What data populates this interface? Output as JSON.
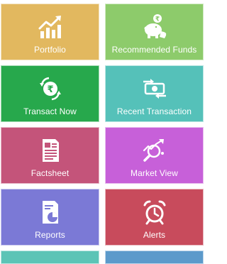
{
  "tiles": [
    {
      "label": "Portfolio",
      "icon": "growth-chart-icon",
      "color": "#e2b85f"
    },
    {
      "label": "Recommended Funds",
      "icon": "piggy-bank-icon",
      "color": "#8dcb6b"
    },
    {
      "label": "Transact Now",
      "icon": "rupee-exchange-icon",
      "color": "#27a84c"
    },
    {
      "label": "Recent Transaction",
      "icon": "money-transfer-icon",
      "color": "#55c1b9"
    },
    {
      "label": "Factsheet",
      "icon": "document-icon",
      "color": "#c4547a"
    },
    {
      "label": "Market View",
      "icon": "market-search-icon",
      "color": "#c760d9"
    },
    {
      "label": "Reports",
      "icon": "report-pie-icon",
      "color": "#7b79d6"
    },
    {
      "label": "Alerts",
      "icon": "alarm-clock-icon",
      "color": "#c84b5c"
    }
  ],
  "partial_tiles": [
    {
      "color": "#5cc4b6"
    },
    {
      "color": "#5c9acb"
    }
  ]
}
